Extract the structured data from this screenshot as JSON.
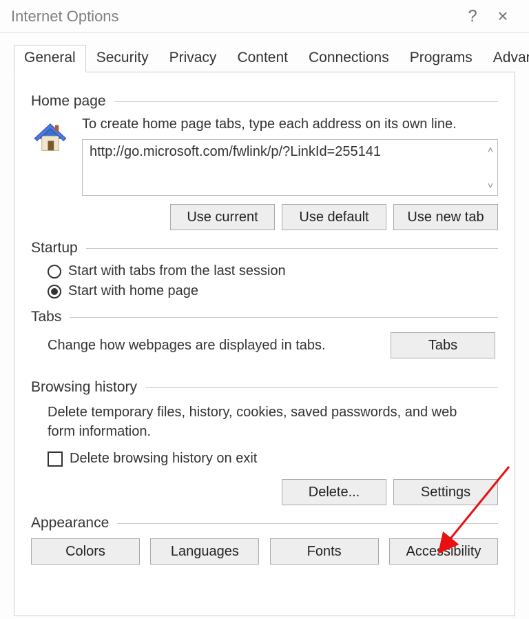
{
  "window": {
    "title": "Internet Options",
    "help": "?",
    "close": "×"
  },
  "tabs": {
    "general": "General",
    "security": "Security",
    "privacy": "Privacy",
    "content": "Content",
    "connections": "Connections",
    "programs": "Programs",
    "advanced": "Advanced"
  },
  "home_page": {
    "label": "Home page",
    "description": "To create home page tabs, type each address on its own line.",
    "url": "http://go.microsoft.com/fwlink/p/?LinkId=255141",
    "use_current": "Use current",
    "use_default": "Use default",
    "use_new_tab": "Use new tab"
  },
  "startup": {
    "label": "Startup",
    "opt_last_session": "Start with tabs from the last session",
    "opt_home_page": "Start with home page"
  },
  "tabs_section": {
    "label": "Tabs",
    "description": "Change how webpages are displayed in tabs.",
    "button": "Tabs"
  },
  "browsing_history": {
    "label": "Browsing history",
    "description": "Delete temporary files, history, cookies, saved passwords, and web form information.",
    "delete_on_exit": "Delete browsing history on exit",
    "delete_btn": "Delete...",
    "settings_btn": "Settings"
  },
  "appearance": {
    "label": "Appearance",
    "colors": "Colors",
    "languages": "Languages",
    "fonts": "Fonts",
    "accessibility": "Accessibility"
  }
}
